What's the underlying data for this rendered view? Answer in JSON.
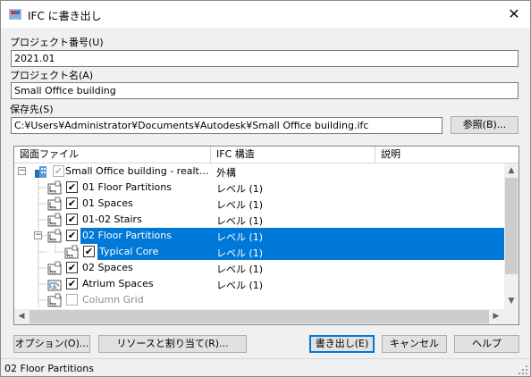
{
  "window": {
    "title": "IFC に書き出し"
  },
  "project_number": {
    "label": "プロジェクト番号(U)",
    "value": "2021.01"
  },
  "project_name": {
    "label": "プロジェクト名(A)",
    "value": "Small Office building"
  },
  "save_to": {
    "label": "保存先(S)",
    "value": "C:¥Users¥Administrator¥Documents¥Autodesk¥Small Office building.ifc",
    "browse_label": "参照(B)..."
  },
  "tree": {
    "columns": [
      "図面ファイル",
      "IFC 構造",
      "説明"
    ],
    "rows": [
      {
        "name": "Small Office building - realt...",
        "structure": "外構",
        "checked": true,
        "gray_check": true,
        "selected": false,
        "icon": "building-icon"
      },
      {
        "name": "01 Floor Partitions",
        "structure": "レベル (1)",
        "checked": true,
        "selected": false,
        "icon": "floor-plan-icon"
      },
      {
        "name": "01 Spaces",
        "structure": "レベル (1)",
        "checked": true,
        "selected": false,
        "icon": "floor-plan-icon"
      },
      {
        "name": "01-02 Stairs",
        "structure": "レベル (1)",
        "checked": true,
        "selected": false,
        "icon": "floor-plan-icon"
      },
      {
        "name": "02 Floor Partitions",
        "structure": "レベル (1)",
        "checked": true,
        "selected": true,
        "icon": "floor-plan-icon"
      },
      {
        "name": "Typical Core",
        "structure": "レベル (1)",
        "checked": true,
        "selected": true,
        "icon": "floor-plan-icon"
      },
      {
        "name": "02 Spaces",
        "structure": "レベル (1)",
        "checked": true,
        "selected": false,
        "icon": "floor-plan-icon"
      },
      {
        "name": "Atrium Spaces",
        "structure": "レベル (1)",
        "checked": true,
        "selected": false,
        "icon": "section-icon"
      },
      {
        "name": "Column Grid",
        "structure": "",
        "checked": false,
        "gray_check": true,
        "grayed": true,
        "selected": false,
        "icon": "floor-plan-icon"
      }
    ]
  },
  "buttons": {
    "options": "オプション(O)...",
    "resource_assign": "リソースと割り当て(R)...",
    "export": "書き出し(E)",
    "cancel": "キャンセル",
    "help": "ヘルプ"
  },
  "status": {
    "text": "02 Floor Partitions"
  },
  "colors": {
    "selection": "#0078d7",
    "window_bg": "#f0f0f0"
  }
}
